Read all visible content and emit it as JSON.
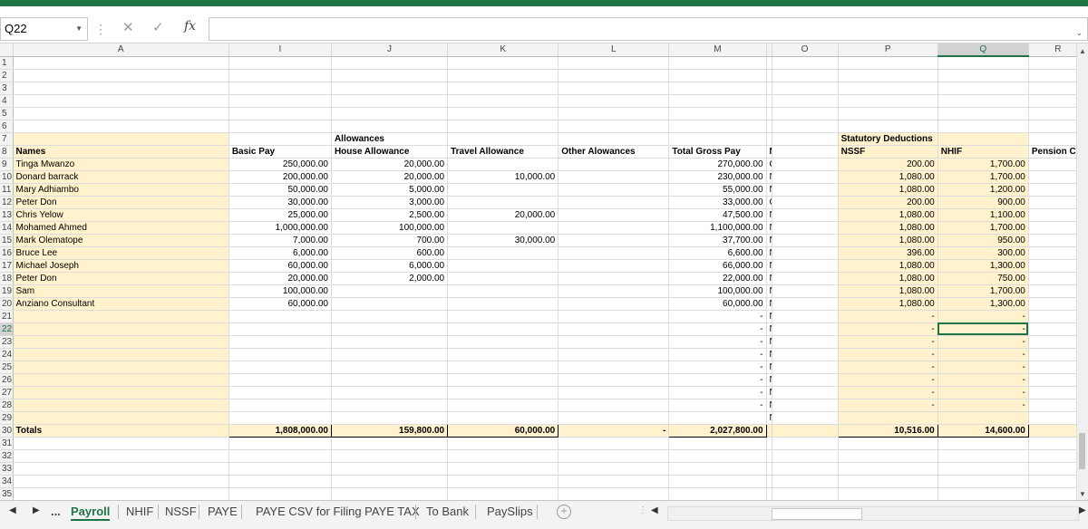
{
  "formula_bar": {
    "name_box": "Q22",
    "fx": "fx",
    "formula": ""
  },
  "columns": [
    "A",
    "I",
    "J",
    "K",
    "L",
    "M",
    "N",
    "O",
    "P",
    "Q",
    "R"
  ],
  "col_headers": [
    "",
    "A",
    "I",
    "J",
    "K",
    "L",
    "M",
    "",
    "O",
    "P",
    "Q",
    "R"
  ],
  "row_numbers": [
    "1",
    "2",
    "3",
    "4",
    "5",
    "6",
    "7",
    "8",
    "9",
    "10",
    "11",
    "12",
    "13",
    "14",
    "15",
    "16",
    "17",
    "18",
    "19",
    "20",
    "21",
    "22",
    "23",
    "24",
    "25",
    "26",
    "27",
    "28",
    "29",
    "30",
    "31",
    "32",
    "33",
    "34",
    "35"
  ],
  "headers": {
    "allowances": "Allowances",
    "statutory": "Statutory Deductions",
    "names": "Names",
    "basic_pay": "Basic Pay",
    "house_allowance": "House Allowance",
    "travel_allowance": "Travel Allowance",
    "other_allowances": "Other Alowances",
    "total_gross": "Total Gross Pay",
    "nssf_rates": "NSSF Rates",
    "nssf": "NSSF",
    "nhif": "NHIF",
    "pension": "Pension Con"
  },
  "rows": [
    {
      "name": "Tinga Mwanzo",
      "basic": "250,000.00",
      "house": "20,000.00",
      "travel": "",
      "other": "",
      "gross": "270,000.00",
      "rate": "Old",
      "nssf": "200.00",
      "nhif": "1,700.00"
    },
    {
      "name": "Donard barrack",
      "basic": "200,000.00",
      "house": "20,000.00",
      "travel": "10,000.00",
      "other": "",
      "gross": "230,000.00",
      "rate": "New",
      "nssf": "1,080.00",
      "nhif": "1,700.00"
    },
    {
      "name": "Mary Adhiambo",
      "basic": "50,000.00",
      "house": "5,000.00",
      "travel": "",
      "other": "",
      "gross": "55,000.00",
      "rate": "New",
      "nssf": "1,080.00",
      "nhif": "1,200.00"
    },
    {
      "name": "Peter Don",
      "basic": "30,000.00",
      "house": "3,000.00",
      "travel": "",
      "other": "",
      "gross": "33,000.00",
      "rate": "Old",
      "nssf": "200.00",
      "nhif": "900.00"
    },
    {
      "name": "Chris Yelow",
      "basic": "25,000.00",
      "house": "2,500.00",
      "travel": "20,000.00",
      "other": "",
      "gross": "47,500.00",
      "rate": "New",
      "nssf": "1,080.00",
      "nhif": "1,100.00"
    },
    {
      "name": "Mohamed Ahmed",
      "basic": "1,000,000.00",
      "house": "100,000.00",
      "travel": "",
      "other": "",
      "gross": "1,100,000.00",
      "rate": "New",
      "nssf": "1,080.00",
      "nhif": "1,700.00"
    },
    {
      "name": "Mark Olematope",
      "basic": "7,000.00",
      "house": "700.00",
      "travel": "30,000.00",
      "other": "",
      "gross": "37,700.00",
      "rate": "New",
      "nssf": "1,080.00",
      "nhif": "950.00"
    },
    {
      "name": "Bruce Lee",
      "basic": "6,000.00",
      "house": "600.00",
      "travel": "",
      "other": "",
      "gross": "6,600.00",
      "rate": "New",
      "nssf": "396.00",
      "nhif": "300.00"
    },
    {
      "name": "Michael Joseph",
      "basic": "60,000.00",
      "house": "6,000.00",
      "travel": "",
      "other": "",
      "gross": "66,000.00",
      "rate": "New",
      "nssf": "1,080.00",
      "nhif": "1,300.00"
    },
    {
      "name": "Peter Don",
      "basic": "20,000.00",
      "house": "2,000.00",
      "travel": "",
      "other": "",
      "gross": "22,000.00",
      "rate": "New",
      "nssf": "1,080.00",
      "nhif": "750.00"
    },
    {
      "name": "Sam",
      "basic": "100,000.00",
      "house": "",
      "travel": "",
      "other": "",
      "gross": "100,000.00",
      "rate": "New",
      "nssf": "1,080.00",
      "nhif": "1,700.00"
    },
    {
      "name": "Anziano Consultant",
      "basic": "60,000.00",
      "house": "",
      "travel": "",
      "other": "",
      "gross": "60,000.00",
      "rate": "New",
      "nssf": "1,080.00",
      "nhif": "1,300.00"
    },
    {
      "name": "",
      "basic": "",
      "house": "",
      "travel": "",
      "other": "",
      "gross": "-",
      "rate": "New",
      "nssf": "-",
      "nhif": "-"
    },
    {
      "name": "",
      "basic": "",
      "house": "",
      "travel": "",
      "other": "",
      "gross": "-",
      "rate": "New",
      "nssf": "-",
      "nhif": "-"
    },
    {
      "name": "",
      "basic": "",
      "house": "",
      "travel": "",
      "other": "",
      "gross": "-",
      "rate": "New",
      "nssf": "-",
      "nhif": "-"
    },
    {
      "name": "",
      "basic": "",
      "house": "",
      "travel": "",
      "other": "",
      "gross": "-",
      "rate": "New",
      "nssf": "-",
      "nhif": "-"
    },
    {
      "name": "",
      "basic": "",
      "house": "",
      "travel": "",
      "other": "",
      "gross": "-",
      "rate": "New",
      "nssf": "-",
      "nhif": "-"
    },
    {
      "name": "",
      "basic": "",
      "house": "",
      "travel": "",
      "other": "",
      "gross": "-",
      "rate": "New",
      "nssf": "-",
      "nhif": "-"
    },
    {
      "name": "",
      "basic": "",
      "house": "",
      "travel": "",
      "other": "",
      "gross": "-",
      "rate": "New",
      "nssf": "-",
      "nhif": "-"
    },
    {
      "name": "",
      "basic": "",
      "house": "",
      "travel": "",
      "other": "",
      "gross": "-",
      "rate": "New",
      "nssf": "-",
      "nhif": "-"
    },
    {
      "name": "",
      "basic": "",
      "house": "",
      "travel": "",
      "other": "",
      "gross": "",
      "rate": "New",
      "nssf": "",
      "nhif": ""
    }
  ],
  "totals": {
    "label": "Totals",
    "basic": "1,808,000.00",
    "house": "159,800.00",
    "travel": "60,000.00",
    "other": "-",
    "gross": "2,027,800.00",
    "nssf": "10,516.00",
    "nhif": "14,600.00"
  },
  "sheet_tabs": {
    "more": "...",
    "items": [
      "Payroll",
      "NHIF",
      "NSSF",
      "PAYE",
      "PAYE CSV for Filing PAYE TAX",
      "To Bank",
      "PaySlips"
    ],
    "add": "+"
  },
  "colors": {
    "excel_green": "#217346",
    "header_fill": "#fff2cc"
  }
}
